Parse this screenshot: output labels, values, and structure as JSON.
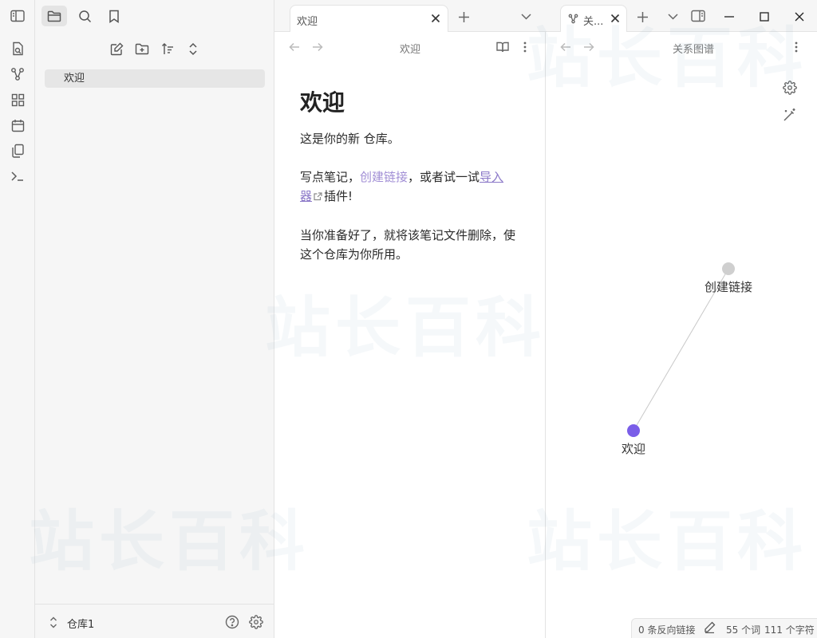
{
  "left_sidebar": {
    "file_item": "欢迎",
    "vault_name": "仓库1"
  },
  "editor": {
    "tab_title": "欢迎",
    "view_title": "欢迎",
    "note": {
      "heading": "欢迎",
      "p1": "这是你的新 仓库。",
      "p2_prefix": "写点笔记，",
      "p2_link": "创建链接",
      "p2_mid": "，或者试一试",
      "p2_external_link": "导入器",
      "p2_suffix": "插件!",
      "p3": "当你准备好了，就将该笔记文件删除，使这个仓库为你所用。"
    }
  },
  "graph": {
    "tab_title": "关...",
    "view_title": "关系图谱",
    "nodes": [
      {
        "label": "创建链接",
        "color": "#cfcfcf"
      },
      {
        "label": "欢迎",
        "color": "#7a5ee8"
      }
    ]
  },
  "status_bar": {
    "backlinks": "0 条反向链接",
    "words": "55 个词",
    "chars": "111 个字符"
  },
  "watermark": "站长百科",
  "colors": {
    "accent": "#7a5ee8",
    "internal_link": "#a18ed5",
    "sidebar_bg": "#f6f6f6",
    "border": "#e3e3e3"
  }
}
